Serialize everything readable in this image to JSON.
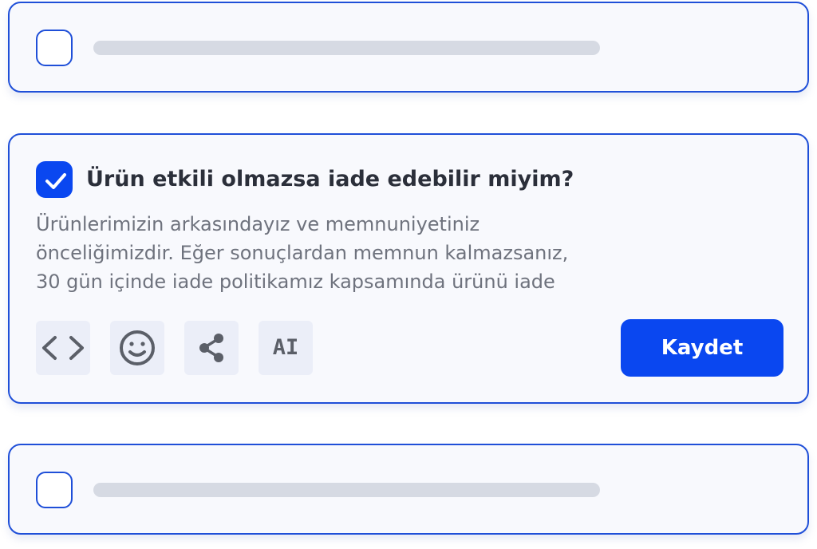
{
  "faq_items": [
    {
      "state": "collapsed",
      "checked": false
    },
    {
      "state": "expanded",
      "checked": true,
      "question": "Ürün etkili olmazsa iade edebilir miyim?",
      "answer_lines": [
        "Ürünlerimizin arkasındayız ve memnuniyetiniz",
        "önceliğimizdir. Eğer sonuçlardan memnun kalmazsanız,",
        "30 gün içinde iade politikamız kapsamında ürünü iade"
      ],
      "toolbar": {
        "tools": [
          {
            "icon": "code-icon"
          },
          {
            "icon": "emoji-icon"
          },
          {
            "icon": "share-icon"
          },
          {
            "icon": "ai-icon",
            "label": "AI"
          }
        ],
        "save_label": "Kaydet"
      }
    },
    {
      "state": "collapsed",
      "checked": false
    }
  ],
  "colors": {
    "accent": "#0a47f0",
    "card_border": "#1f4fd8",
    "card_background": "#f8f9fd",
    "question_text": "#2b2f3a",
    "answer_text": "#6e727d",
    "placeholder": "#d6dae3",
    "tool_background": "#ebeef8",
    "icon": "#5b5f68"
  }
}
